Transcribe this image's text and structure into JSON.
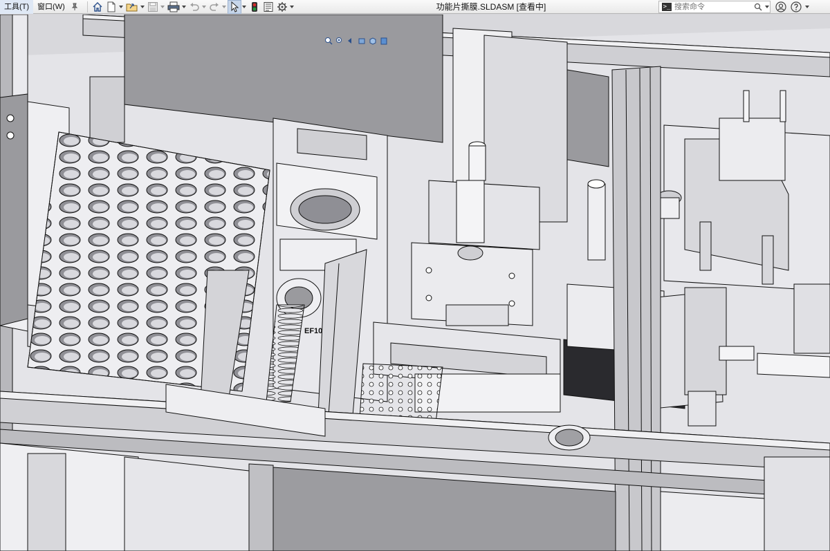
{
  "menu": {
    "tools": "工具(T)",
    "window": "窗口(W)"
  },
  "toolbar": {
    "icons": [
      "pin-icon",
      "home-icon",
      "new-icon",
      "open-icon",
      "save-icon",
      "print-icon",
      "undo-icon",
      "redo-icon",
      "select-icon",
      "rebuild-icon",
      "file-properties-icon",
      "options-icon"
    ]
  },
  "document": {
    "title": "功能片撕膜.SLDASM [查看中]"
  },
  "search": {
    "placeholder": "搜索命令"
  },
  "model": {
    "part_label": "EF10"
  },
  "colors": {
    "background": "#d8d8dc",
    "part_face": "#e6e6ea",
    "part_shadow": "#9a9a9e",
    "edge": "#1a1a1a",
    "rebuild_green": "#1f9e3a",
    "rebuild_red": "#d42a2a"
  }
}
